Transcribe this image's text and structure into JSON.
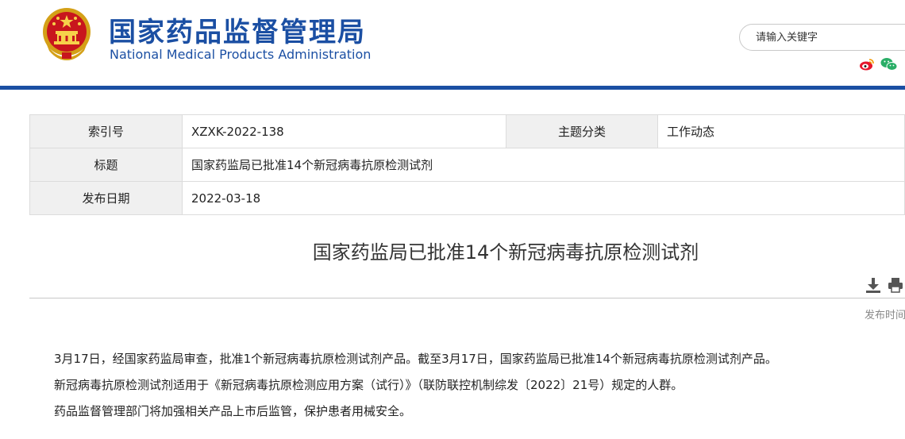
{
  "header": {
    "title_cn": "国家药品监督管理局",
    "title_en": "National Medical Products Administration",
    "search_placeholder": "请输入关键字",
    "social_icons": [
      "weibo-icon",
      "wechat-icon"
    ],
    "brand_color": "#1b4fa3"
  },
  "info": {
    "index_label": "索引号",
    "index_value": "XZXK-2022-138",
    "category_label": "主题分类",
    "category_value": "工作动态",
    "title_label": "标题",
    "title_value": "国家药监局已批准14个新冠病毒抗原检测试剂",
    "date_label": "发布日期",
    "date_value": "2022-03-18"
  },
  "article": {
    "title": "国家药监局已批准14个新冠病毒抗原检测试剂",
    "pubtime_label": "发布时间",
    "tools": [
      "download-icon",
      "print-icon"
    ],
    "paragraphs": [
      "3月17日，经国家药监局审查，批准1个新冠病毒抗原检测试剂产品。截至3月17日，国家药监局已批准14个新冠病毒抗原检测试剂产品。",
      "新冠病毒抗原检测试剂适用于《新冠病毒抗原检测应用方案（试行）》（联防联控机制综发〔2022〕21号）规定的人群。",
      "药品监督管理部门将加强相关产品上市后监管，保护患者用械安全。"
    ]
  }
}
